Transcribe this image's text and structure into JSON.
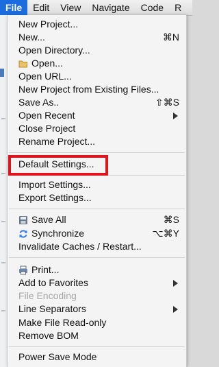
{
  "menubar": {
    "items": [
      "File",
      "Edit",
      "View",
      "Navigate",
      "Code",
      "R"
    ]
  },
  "menu": {
    "items": [
      {
        "label": "New Project..."
      },
      {
        "label": "New...",
        "shortcut": "⌘N"
      },
      {
        "label": "Open Directory..."
      },
      {
        "label": "Open...",
        "icon": "folder-icon"
      },
      {
        "label": "Open URL..."
      },
      {
        "label": "New Project from Existing Files..."
      },
      {
        "label": "Save As..",
        "shortcut": "⇧⌘S"
      },
      {
        "label": "Open Recent",
        "submenu": true
      },
      {
        "label": "Close Project"
      },
      {
        "label": "Rename Project..."
      },
      {
        "label": "Default Settings...",
        "highlighted": true
      },
      {
        "label": "Import Settings..."
      },
      {
        "label": "Export Settings..."
      },
      {
        "label": "Save All",
        "shortcut": "⌘S",
        "icon": "save-icon"
      },
      {
        "label": "Synchronize",
        "shortcut": "⌥⌘Y",
        "icon": "sync-icon"
      },
      {
        "label": "Invalidate Caches / Restart..."
      },
      {
        "label": "Print...",
        "icon": "print-icon"
      },
      {
        "label": "Add to Favorites",
        "submenu": true
      },
      {
        "label": "File Encoding",
        "disabled": true
      },
      {
        "label": "Line Separators",
        "submenu": true
      },
      {
        "label": "Make File Read-only"
      },
      {
        "label": "Remove BOM"
      },
      {
        "label": "Power Save Mode"
      }
    ]
  },
  "colors": {
    "menubar_active": "#1b6ddf",
    "highlight_box": "#e0141c",
    "disabled_text": "#a6a6a6",
    "sync_icon": "#2f7fe0"
  }
}
